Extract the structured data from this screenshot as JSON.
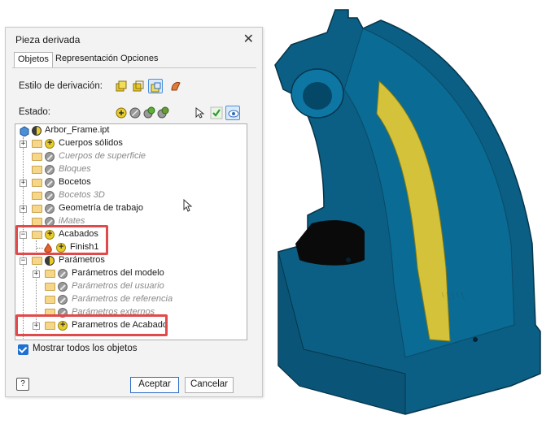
{
  "dialog": {
    "title": "Pieza derivada",
    "close_glyph": "✕",
    "tabs": [
      {
        "label": "Objetos",
        "active": true
      },
      {
        "label": "Representación",
        "active": false
      },
      {
        "label": "Opciones",
        "active": false
      }
    ],
    "derive_style_label": "Estilo de derivación:",
    "state_label": "Estado:",
    "derive_style_icons": [
      "single-solid-icon",
      "solid-body-icon",
      "surface-body-icon",
      "composite-icon"
    ],
    "state_icons": [
      "include-icon",
      "exclude-icon",
      "include-toggle-icon",
      "exclude-toggle-icon",
      "select-cursor-icon",
      "checkmark-icon",
      "eye-icon"
    ],
    "tree": [
      {
        "label": "Arbor_Frame.ipt",
        "state": "half",
        "level": 0
      },
      {
        "label": "Cuerpos sólidos",
        "state": "plus",
        "level": 1,
        "expander": "+"
      },
      {
        "label": "Cuerpos de superficie",
        "state": "ex",
        "level": 1,
        "muted": true
      },
      {
        "label": "Bloques",
        "state": "ex",
        "level": 1,
        "muted": true
      },
      {
        "label": "Bocetos",
        "state": "ex",
        "level": 1,
        "expander": "+"
      },
      {
        "label": "Bocetos 3D",
        "state": "ex",
        "level": 1,
        "muted": true
      },
      {
        "label": "Geometría de trabajo",
        "state": "ex",
        "level": 1,
        "expander": "+"
      },
      {
        "label": "iMates",
        "state": "ex",
        "level": 1,
        "muted": true
      },
      {
        "label": "Acabados",
        "state": "plus",
        "level": 1,
        "expander": "−"
      },
      {
        "label": "Finish1",
        "state": "plus",
        "level": 2
      },
      {
        "label": "Parámetros",
        "state": "half",
        "level": 1,
        "expander": "−"
      },
      {
        "label": "Parámetros del modelo",
        "state": "ex",
        "level": 2,
        "expander": "+"
      },
      {
        "label": "Parámetros del usuario",
        "state": "ex",
        "level": 2,
        "muted": true
      },
      {
        "label": "Parámetros de referencia",
        "state": "ex",
        "level": 2,
        "muted": true
      },
      {
        "label": "Parámetros externos",
        "state": "ex",
        "level": 2,
        "muted": true
      },
      {
        "label": "Parametros de Acabado",
        "state": "plus",
        "level": 2,
        "expander": "+"
      }
    ],
    "show_all_label": "Mostrar todos los objetos",
    "show_all_checked": true,
    "ok_label": "Aceptar",
    "cancel_label": "Cancelar",
    "help_glyph": "?"
  },
  "viewport": {
    "part_color": "#0b5f84",
    "finish_color": "#d4c33a",
    "engraving_lines": [
      "~~~~",
      "~~~~~~",
      "~~~~~",
      "~~~~",
      "~~~~~~"
    ]
  }
}
